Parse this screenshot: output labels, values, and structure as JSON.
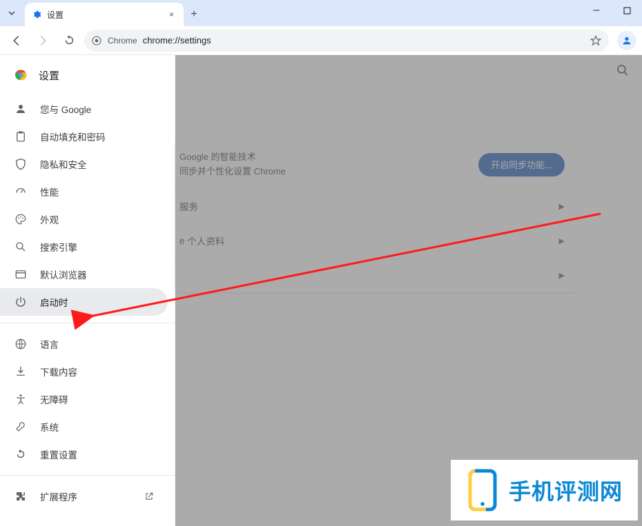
{
  "window": {
    "minimize": "–",
    "maximize": "□",
    "close": "×"
  },
  "tab": {
    "title": "设置",
    "close": "×",
    "new": "+"
  },
  "toolbar": {
    "chip": "Chrome",
    "url": "chrome://settings"
  },
  "sidebar": {
    "title": "设置",
    "items": [
      {
        "label": "您与 Google",
        "icon": "person"
      },
      {
        "label": "自动填充和密码",
        "icon": "clipboard"
      },
      {
        "label": "隐私和安全",
        "icon": "shield"
      },
      {
        "label": "性能",
        "icon": "gauge"
      },
      {
        "label": "外观",
        "icon": "palette"
      },
      {
        "label": "搜索引擎",
        "icon": "search"
      },
      {
        "label": "默认浏览器",
        "icon": "browser"
      },
      {
        "label": "启动时",
        "icon": "power",
        "active": true
      }
    ],
    "items2": [
      {
        "label": "语言",
        "icon": "globe"
      },
      {
        "label": "下载内容",
        "icon": "download"
      },
      {
        "label": "无障碍",
        "icon": "accessibility"
      },
      {
        "label": "系统",
        "icon": "wrench"
      },
      {
        "label": "重置设置",
        "icon": "restore"
      }
    ],
    "extensions": {
      "label": "扩展程序",
      "icon": "puzzle"
    }
  },
  "main": {
    "card_line1": "Google 的智能技术",
    "card_line2": "同步并个性化设置 Chrome",
    "sync_button": "开启同步功能...",
    "row1": "服务",
    "row1b": "",
    "row2": "个人资料",
    "row2_prefix": "e"
  },
  "watermark": {
    "text": "手机评测网"
  }
}
